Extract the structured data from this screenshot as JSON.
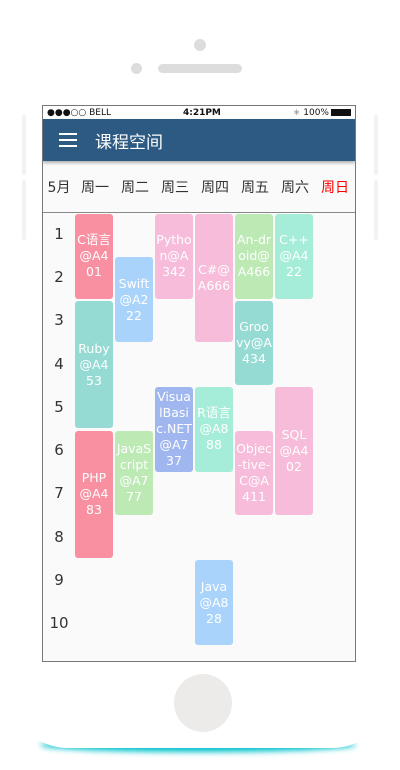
{
  "status": {
    "carrier": "●●●○○ BELL",
    "time": "4:21PM",
    "battery": "100%"
  },
  "header": {
    "title": "课程空间"
  },
  "days": {
    "month": "5月",
    "labels": [
      "周一",
      "周二",
      "周三",
      "周四",
      "周五",
      "周六",
      "周日"
    ],
    "sunday_color": "#ff0000"
  },
  "periods": [
    "1",
    "2",
    "3",
    "4",
    "5",
    "6",
    "7",
    "8",
    "9",
    "10"
  ],
  "courses": [
    {
      "text": "C语言@A401",
      "day": 1,
      "start": 1,
      "span": 2,
      "color": "#f890a2"
    },
    {
      "text": "Swift@A222",
      "day": 2,
      "start": 2,
      "span": 2,
      "color": "#a9d3fa"
    },
    {
      "text": "Python@A342",
      "day": 3,
      "start": 1,
      "span": 2,
      "color": "#f6bcda"
    },
    {
      "text": "C#@A666",
      "day": 4,
      "start": 1,
      "span": 3,
      "color": "#f6bcda"
    },
    {
      "text": "An-droid@A466",
      "day": 5,
      "start": 1,
      "span": 2,
      "color": "#bde9b5"
    },
    {
      "text": "C++@A422",
      "day": 6,
      "start": 1,
      "span": 2,
      "color": "#a5edd8"
    },
    {
      "text": "Ruby@A453",
      "day": 1,
      "start": 3,
      "span": 3,
      "color": "#96dad4"
    },
    {
      "text": "Groovy@A434",
      "day": 5,
      "start": 3,
      "span": 2,
      "color": "#96dad4"
    },
    {
      "text": "VisualBasic.NET@A737",
      "day": 3,
      "start": 5,
      "span": 2,
      "color": "#9fb6ef"
    },
    {
      "text": "R语言@A888",
      "day": 4,
      "start": 5,
      "span": 2,
      "color": "#a5edd8"
    },
    {
      "text": "SQL@A402",
      "day": 6,
      "start": 5,
      "span": 3,
      "color": "#f6bcda"
    },
    {
      "text": "PHP@A483",
      "day": 1,
      "start": 6,
      "span": 3,
      "color": "#f890a2"
    },
    {
      "text": "JavaScript@A777",
      "day": 2,
      "start": 6,
      "span": 2,
      "color": "#bde9b5"
    },
    {
      "text": "Objec-tive-C@A411",
      "day": 5,
      "start": 6,
      "span": 2,
      "color": "#f6bcda"
    },
    {
      "text": "Java@A828",
      "day": 4,
      "start": 9,
      "span": 2,
      "color": "#a9d3fa"
    }
  ]
}
